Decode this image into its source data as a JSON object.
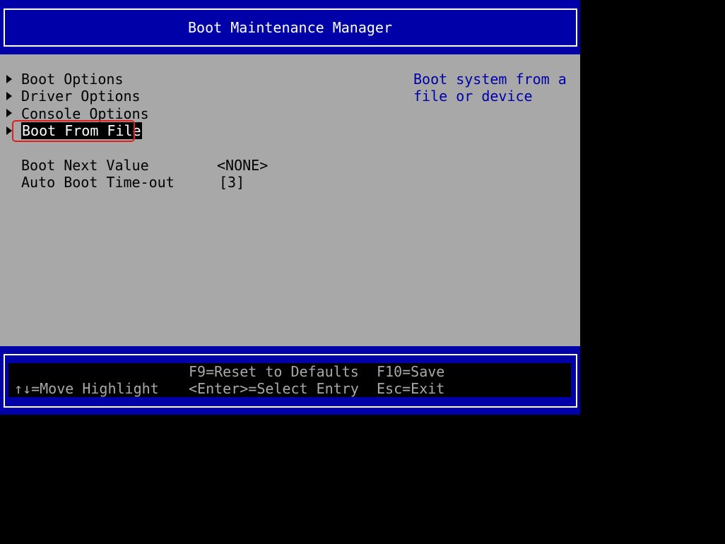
{
  "header": {
    "title": "Boot Maintenance Manager"
  },
  "menu": {
    "items": [
      {
        "label": "Boot Options"
      },
      {
        "label": "Driver Options"
      },
      {
        "label": "Console Options"
      },
      {
        "label": "Boot From File",
        "selected": true
      }
    ]
  },
  "settings": {
    "boot_next_label": "Boot Next Value",
    "boot_next_value": "<NONE>",
    "timeout_label": "Auto Boot Time-out",
    "timeout_value": "[3]"
  },
  "help": {
    "line1": "Boot system from a",
    "line2": "file or device"
  },
  "footer": {
    "move_highlight": "↑↓=Move Highlight",
    "reset_defaults": "F9=Reset to Defaults",
    "select_entry": "<Enter>=Select Entry",
    "save": "F10=Save",
    "exit": "Esc=Exit"
  },
  "colors": {
    "background": "#a8a8a8",
    "header_bg": "#0000a8",
    "help_text": "#0000a8",
    "selected_bg": "#000000",
    "highlight_ring": "#e02020"
  }
}
